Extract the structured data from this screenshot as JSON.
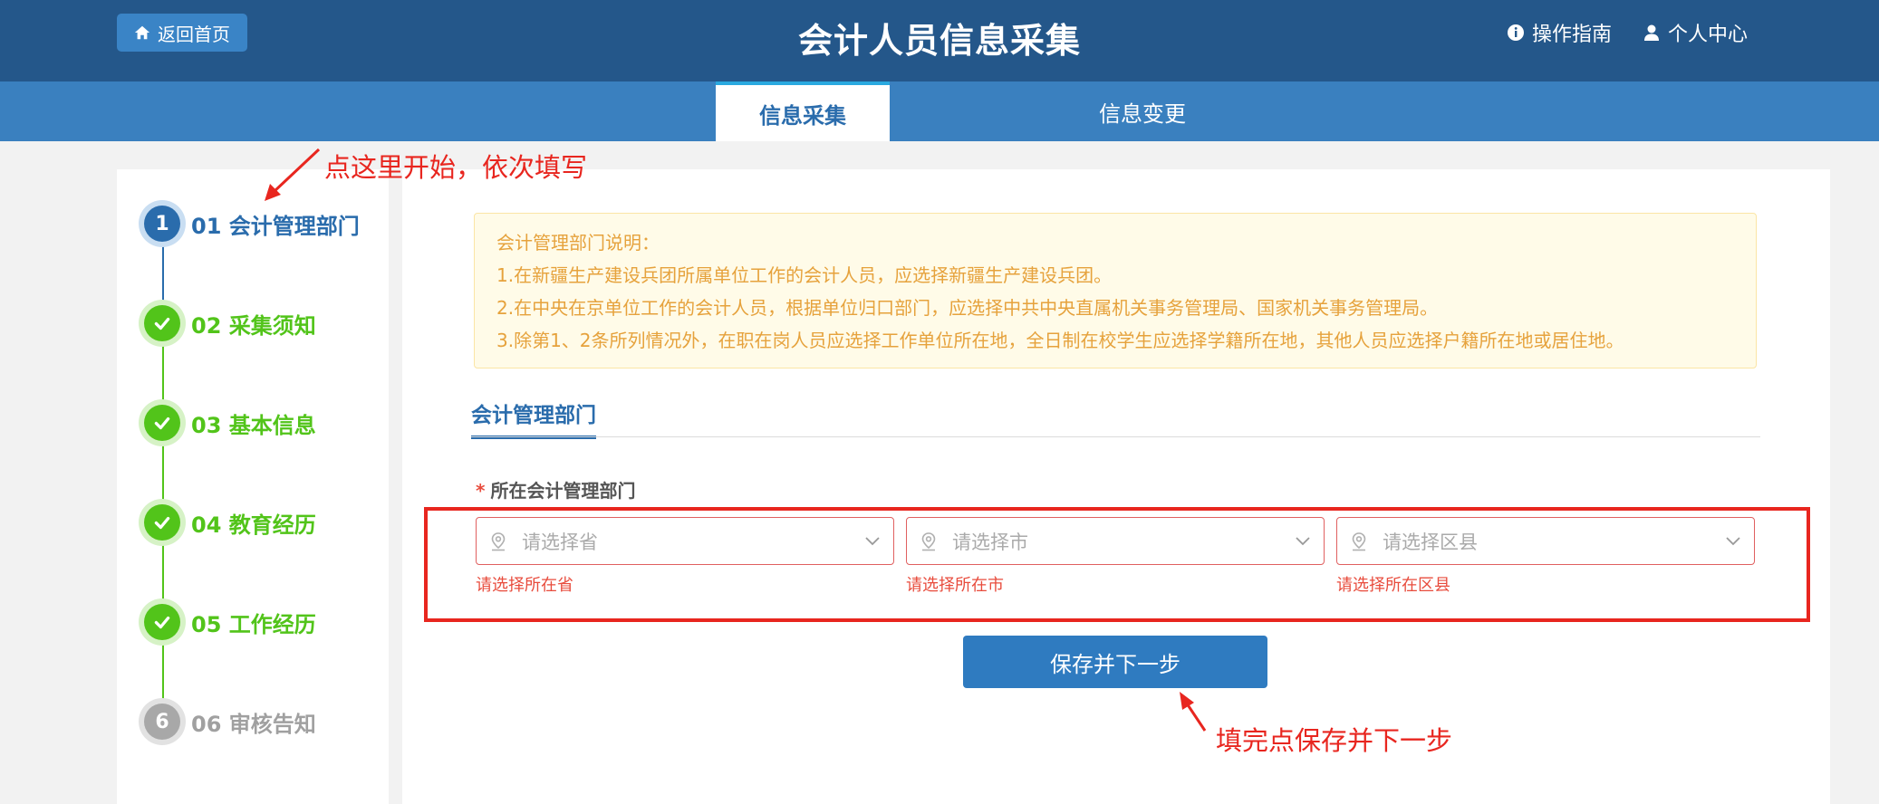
{
  "header": {
    "home_button": "返回首页",
    "title": "会计人员信息采集",
    "guide_link": "操作指南",
    "profile_link": "个人中心"
  },
  "tabs": [
    {
      "label": "信息采集",
      "active": true
    },
    {
      "label": "信息变更",
      "active": false
    }
  ],
  "annotations": {
    "start_hint": "点这里开始，依次填写",
    "save_hint": "填完点保存并下一步"
  },
  "steps": [
    {
      "num": "1",
      "label": "01 会计管理部门",
      "state": "active"
    },
    {
      "num": "2",
      "label": "02 采集须知",
      "state": "done"
    },
    {
      "num": "3",
      "label": "03 基本信息",
      "state": "done"
    },
    {
      "num": "4",
      "label": "04 教育经历",
      "state": "done"
    },
    {
      "num": "5",
      "label": "05 工作经历",
      "state": "done"
    },
    {
      "num": "6",
      "label": "06 审核告知",
      "state": "pending"
    }
  ],
  "notice": {
    "heading": "会计管理部门说明：",
    "items": [
      "1.在新疆生产建设兵团所属单位工作的会计人员，应选择新疆生产建设兵团。",
      "2.在中央在京单位工作的会计人员，根据单位归口部门，应选择中共中央直属机关事务管理局、国家机关事务管理局。",
      "3.除第1、2条所列情况外，在职在岗人员应选择工作单位所在地，全日制在校学生应选择学籍所在地，其他人员应选择户籍所在地或居住地。"
    ]
  },
  "section": {
    "title": "会计管理部门",
    "field_label": "所在会计管理部门",
    "required_mark": "*"
  },
  "selects": [
    {
      "placeholder": "请选择省",
      "error": "请选择所在省"
    },
    {
      "placeholder": "请选择市",
      "error": "请选择所在市"
    },
    {
      "placeholder": "请选择区县",
      "error": "请选择所在区县"
    }
  ],
  "save_button": "保存并下一步",
  "colors": {
    "header_bg": "#24578a",
    "tabbar_bg": "#3a80bf",
    "primary": "#2a6cac",
    "success": "#52c41a",
    "warning_text": "#e6a23c",
    "error": "#e84c3d",
    "annotation": "#e8261f"
  }
}
